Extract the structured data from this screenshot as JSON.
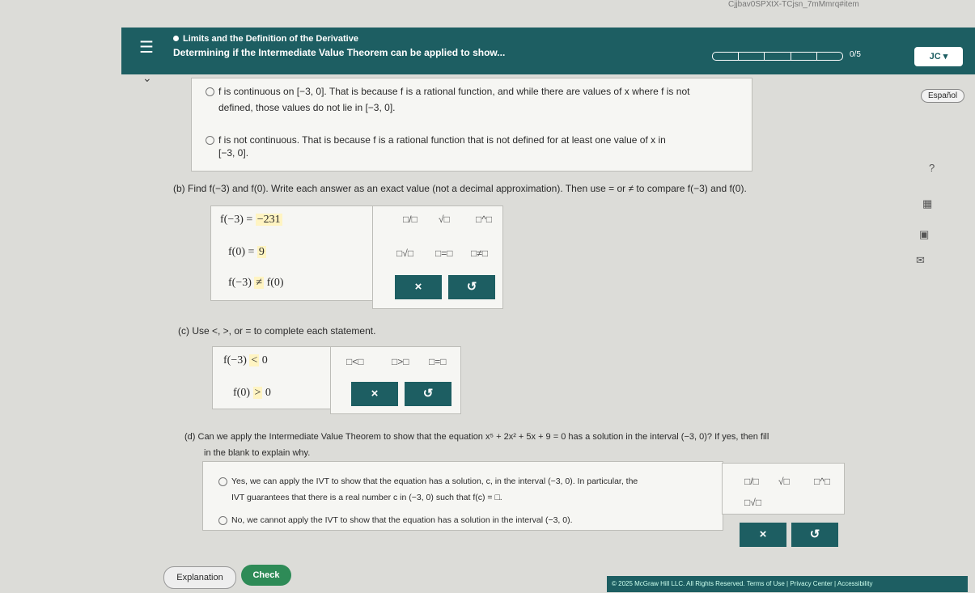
{
  "url_fragment": "Cjjbav0SPXtX-TCjsn_7mMmrq#item",
  "header": {
    "breadcrumb": "Limits and the Definition of the Derivative",
    "title": "Determining if the Intermediate Value Theorem can be applied to show...",
    "progress_label": "0/5",
    "user_label": "JC ▾"
  },
  "espanol": "Español",
  "part_a": {
    "opt1_line1": "f is continuous on [−3, 0]. That is because f is a rational function, and while there are values of x where f is not",
    "opt1_line2": "defined, those values do not lie in [−3, 0].",
    "opt2_line1": "f is not continuous. That is because f is a rational function that is not defined for at least one value of x in",
    "opt2_line2": "[−3, 0]."
  },
  "part_b": {
    "prompt": "(b)  Find f(−3) and f(0). Write each answer as an exact value (not a decimal approximation). Then use = or ≠ to compare f(−3) and f(0).",
    "line1_lhs": "f(−3) =",
    "line1_ans": "−231",
    "line2_lhs": "f(0) =",
    "line2_ans": "9",
    "line3_lhs": "f(−3)",
    "line3_op": "≠",
    "line3_rhs": "f(0)",
    "pal_frac": "□/□",
    "pal_sqrt": "√□",
    "pal_pow": "□^□",
    "pal_nroot": "□√□",
    "pal_eq": "□=□",
    "pal_neq": "□≠□",
    "btn_x": "×",
    "btn_undo": "↺"
  },
  "part_c": {
    "prompt": "(c)  Use <, >, or = to complete each statement.",
    "line1_lhs": "f(−3)",
    "line1_op": "<",
    "line1_rhs": "0",
    "line2_lhs": "f(0)",
    "line2_op": ">",
    "line2_rhs": "0",
    "pal_lt": "□<□",
    "pal_gt": "□>□",
    "pal_eq": "□=□",
    "btn_x": "×",
    "btn_undo": "↺"
  },
  "part_d": {
    "prompt_line1": "(d)  Can we apply the Intermediate Value Theorem to show that the equation x⁵ + 2x² + 5x + 9 = 0 has a solution in the interval (−3, 0)? If yes, then fill",
    "prompt_line2": "in the blank to explain why.",
    "yes_line1": "Yes, we can apply the IVT to show that the equation has a solution, c, in the interval (−3, 0). In particular, the",
    "yes_line2": "IVT guarantees that there is a real number c in (−3, 0) such that f(c) = □.",
    "no_line": "No, we cannot apply the IVT to show that the equation has a solution in the interval (−3, 0).",
    "pal_frac": "□/□",
    "pal_sqrt": "√□",
    "pal_pow": "□^□",
    "pal_nroot": "□√□",
    "btn_x": "×",
    "btn_undo": "↺"
  },
  "buttons": {
    "explanation": "Explanation",
    "check": "Check"
  },
  "footer": "© 2025 McGraw Hill LLC. All Rights Reserved.   Terms of Use  |  Privacy Center  |  Accessibility"
}
